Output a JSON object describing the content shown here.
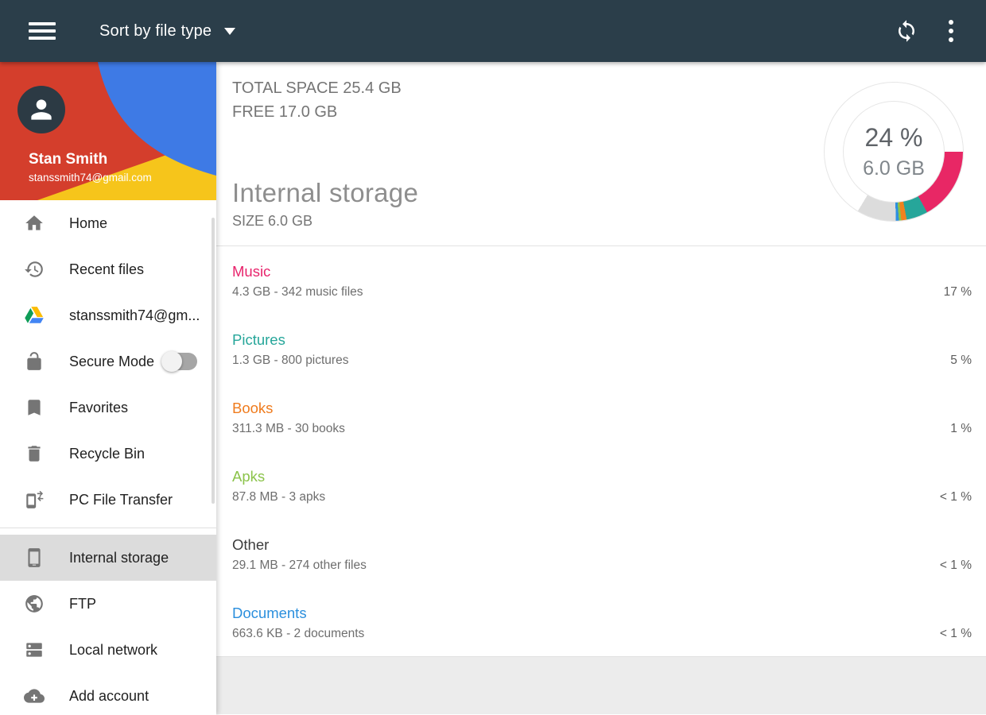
{
  "appbar": {
    "title": "Sort by file type",
    "menu_icon": "hamburger-menu",
    "refresh_icon": "sync-refresh",
    "overflow_icon": "more-vert"
  },
  "profile": {
    "name": "Stan Smith",
    "email": "stanssmith74@gmail.com",
    "avatar_icon": "person",
    "colors": {
      "red": "#d43e2c",
      "blue": "#3e7ae5",
      "yellow": "#f6c51b"
    }
  },
  "sidebar": {
    "items": [
      {
        "label": "Home",
        "icon": "home"
      },
      {
        "label": "Recent files",
        "icon": "history"
      },
      {
        "label": "stanssmith74@gm...",
        "icon": "google-drive"
      },
      {
        "label": "Secure Mode",
        "icon": "lock-open",
        "toggle": "off"
      },
      {
        "label": "Favorites",
        "icon": "bookmark"
      },
      {
        "label": "Recycle Bin",
        "icon": "trash"
      },
      {
        "label": "PC File Transfer",
        "icon": "phone-transfer"
      },
      {
        "label": "Internal storage",
        "icon": "smartphone",
        "selected": true
      },
      {
        "label": "FTP",
        "icon": "globe"
      },
      {
        "label": "Local network",
        "icon": "server"
      },
      {
        "label": "Add account",
        "icon": "cloud-plus"
      }
    ]
  },
  "storage_header": {
    "total_label": "TOTAL SPACE 25.4 GB",
    "free_label": "FREE 17.0 GB",
    "title": "Internal storage",
    "size_label": "SIZE 6.0 GB"
  },
  "chart_data": {
    "type": "donut",
    "title": "Internal storage usage of total space",
    "center_label": "24 %",
    "center_sublabel": "6.0 GB",
    "total_space_gb": 25.4,
    "free_space_gb": 17.0,
    "this_storage_gb": 6.0,
    "start_deg": 90,
    "segments": [
      {
        "label": "Music",
        "percent_of_total": 17,
        "sweep_deg": 61.2,
        "color": "#e82765"
      },
      {
        "label": "Pictures",
        "percent_of_total": 5,
        "sweep_deg": 18,
        "color": "#26a69a"
      },
      {
        "label": "Books",
        "percent_of_total": 1.2,
        "sweep_deg": 4.5,
        "color": "#f0821f"
      },
      {
        "label": "Apks",
        "percent_of_total": 0.35,
        "sweep_deg": 2,
        "color": "#8bc34a"
      },
      {
        "label": "Documents",
        "percent_of_total": 0.3,
        "sweep_deg": 2.5,
        "color": "#2d8fe0"
      },
      {
        "label": "Other used space",
        "percent_of_total": 9,
        "sweep_deg": 33,
        "color": "#dcdcdc"
      }
    ],
    "unfilled_color": "#ffffff"
  },
  "file_types": [
    {
      "name": "Music",
      "color": "#e8246c",
      "details": "4.3 GB - 342 music files",
      "percent": "17 %"
    },
    {
      "name": "Pictures",
      "color": "#26a69a",
      "details": "1.3 GB - 800 pictures",
      "percent": "5 %"
    },
    {
      "name": "Books",
      "color": "#ef7b1d",
      "details": "311.3 MB - 30 books",
      "percent": "1 %"
    },
    {
      "name": "Apks",
      "color": "#8bc34a",
      "details": "87.8 MB - 3 apks",
      "percent": "< 1 %"
    },
    {
      "name": "Other",
      "color": "#3c3c3c",
      "details": "29.1 MB - 274 other files",
      "percent": "< 1 %"
    },
    {
      "name": "Documents",
      "color": "#2b8fdd",
      "details": "663.6 KB - 2 documents",
      "percent": "< 1 %"
    }
  ]
}
